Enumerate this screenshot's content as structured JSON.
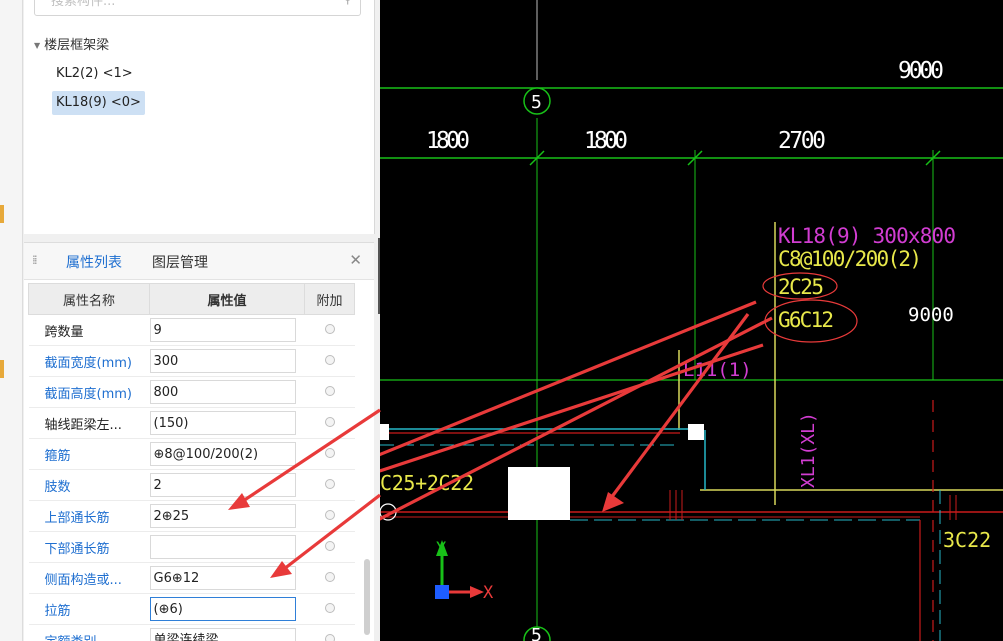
{
  "tree": {
    "search_placeholder": "搜索构件...",
    "group_label": "楼层框架梁",
    "items": [
      "KL2(2) <1>",
      "KL18(9) <0>"
    ]
  },
  "props": {
    "tab_active": "属性列表",
    "tab_other": "图层管理",
    "columns": [
      "属性名称",
      "属性值",
      "附加"
    ],
    "rows": [
      {
        "name": "跨数量",
        "value": "9"
      },
      {
        "name": "截面宽度(mm)",
        "value": "300"
      },
      {
        "name": "截面高度(mm)",
        "value": "800"
      },
      {
        "name": "轴线距梁左...",
        "value": "(150)"
      },
      {
        "name": "箍筋",
        "value": "⊕8@100/200(2)"
      },
      {
        "name": "肢数",
        "value": "2"
      },
      {
        "name": "上部通长筋",
        "value": "2⊕25"
      },
      {
        "name": "下部通长筋",
        "value": ""
      },
      {
        "name": "侧面构造或...",
        "value": "G6⊕12"
      },
      {
        "name": "拉筋",
        "value": "(⊕6)"
      },
      {
        "name": "定额类别",
        "value": "单梁连续梁"
      }
    ]
  },
  "cad": {
    "dims": [
      "9000",
      "1800",
      "1800",
      "2700",
      "9000"
    ],
    "axis_bubbles": [
      "5",
      "5"
    ],
    "beam_label": [
      "KL18(9) 300x800",
      "C8@100/200(2)",
      "2C25",
      "G6C12"
    ],
    "other_labels": [
      "L11(1)",
      "XL1(XL)",
      "C25+2C22",
      "3C22"
    ],
    "ucs": {
      "y": "Y",
      "x": "X"
    },
    "colors": {
      "grid": "#18c018",
      "beam_label": "#d23dd2",
      "highlight": "#e8e84a",
      "arrow": "#e83a3a",
      "wall": "#c91b1b"
    }
  }
}
